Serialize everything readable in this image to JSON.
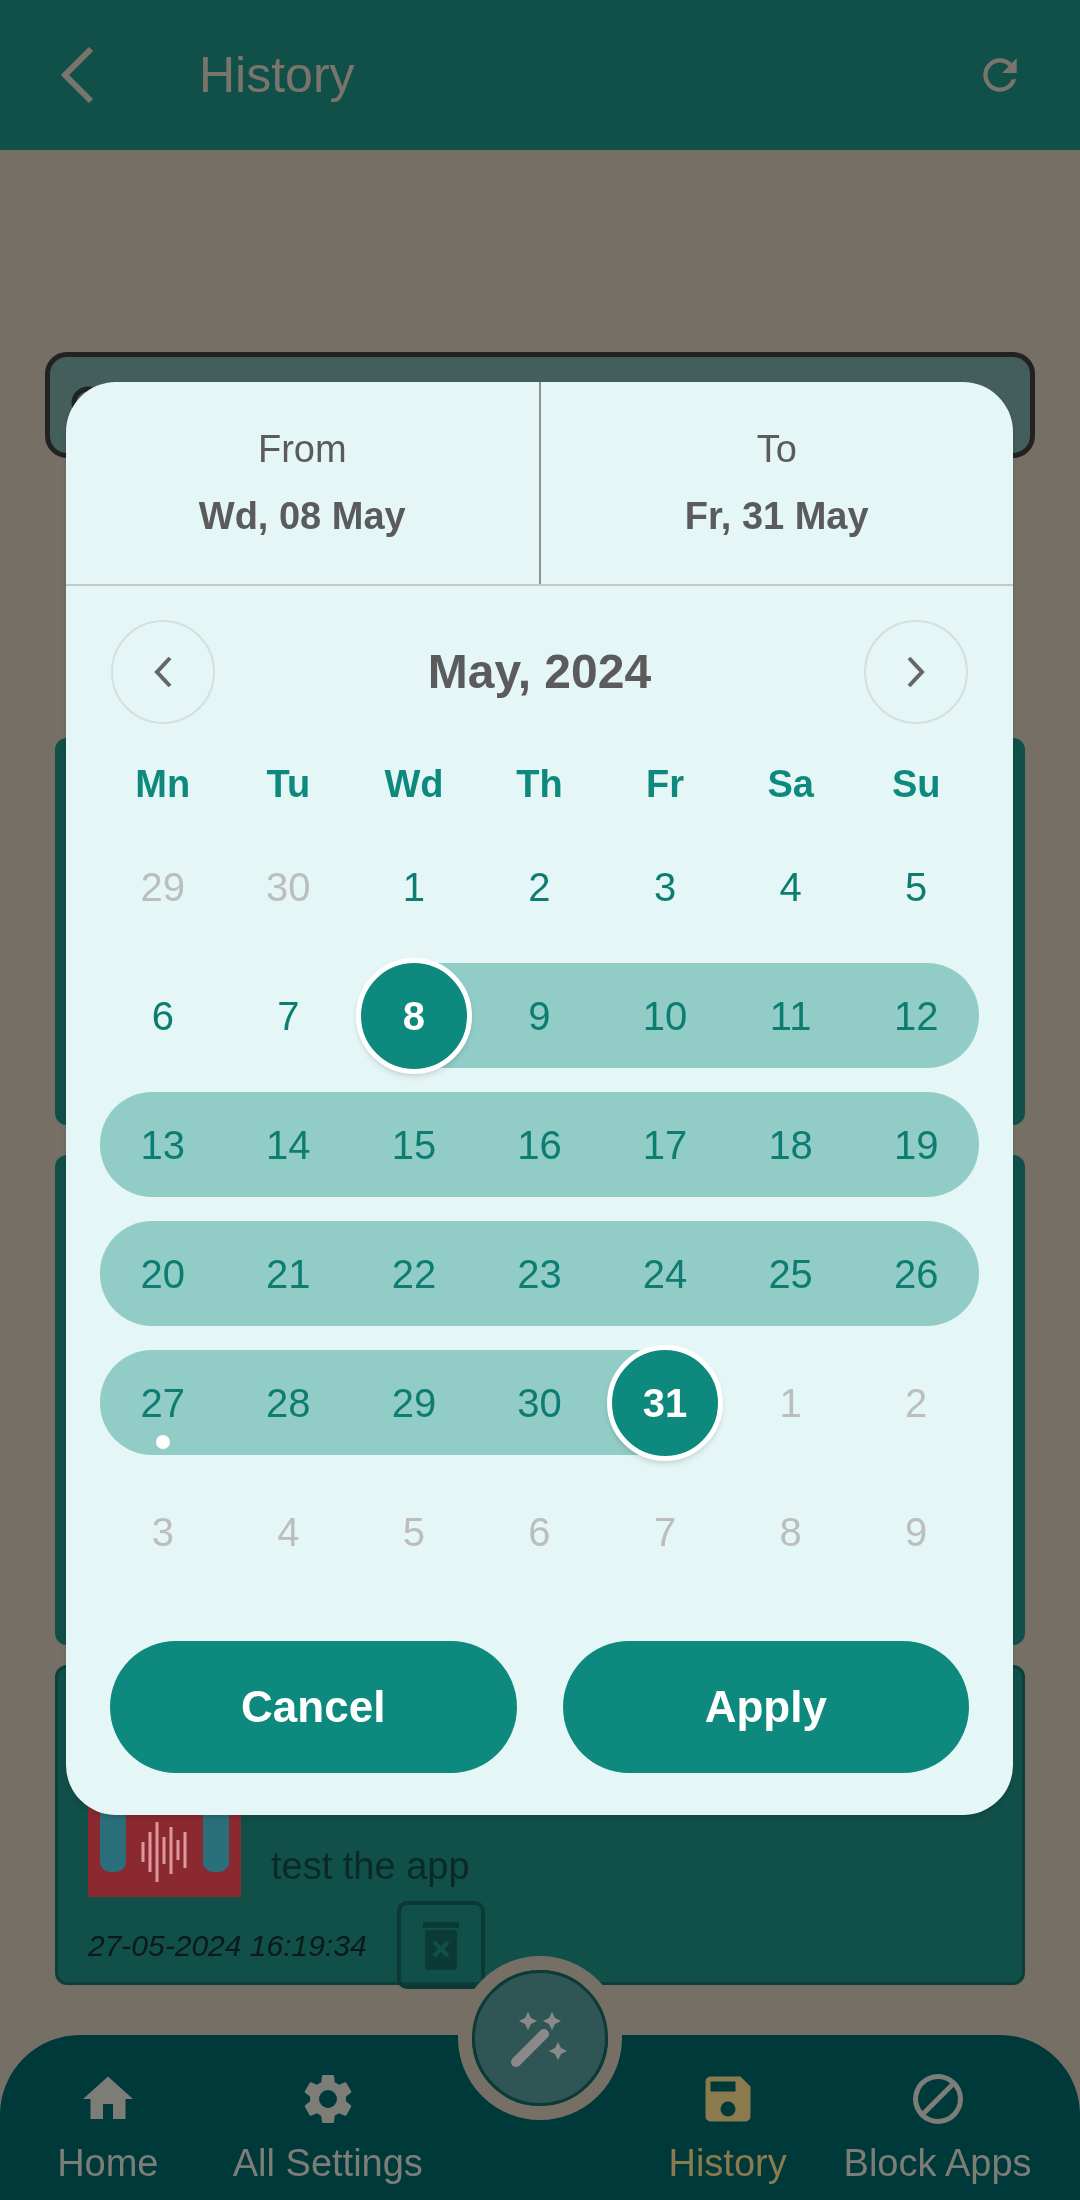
{
  "header": {
    "title": "History"
  },
  "history_item": {
    "title": "test the app",
    "timestamp": "27-05-2024 16:19:34"
  },
  "date_picker": {
    "from": {
      "label": "From",
      "value": "Wd, 08 May"
    },
    "to": {
      "label": "To",
      "value": "Fr, 31 May"
    },
    "month": "May, 2024",
    "weekdays": [
      "Mn",
      "Tu",
      "Wd",
      "Th",
      "Fr",
      "Sa",
      "Su"
    ],
    "weeks": [
      [
        {
          "day": "29",
          "outside": true,
          "in_range": false,
          "selected": false,
          "today": false
        },
        {
          "day": "30",
          "outside": true,
          "in_range": false,
          "selected": false,
          "today": false
        },
        {
          "day": "1",
          "outside": false,
          "in_range": false,
          "selected": false,
          "today": false
        },
        {
          "day": "2",
          "outside": false,
          "in_range": false,
          "selected": false,
          "today": false
        },
        {
          "day": "3",
          "outside": false,
          "in_range": false,
          "selected": false,
          "today": false
        },
        {
          "day": "4",
          "outside": false,
          "in_range": false,
          "selected": false,
          "today": false
        },
        {
          "day": "5",
          "outside": false,
          "in_range": false,
          "selected": false,
          "today": false
        }
      ],
      [
        {
          "day": "6",
          "outside": false,
          "in_range": false,
          "selected": false,
          "today": false
        },
        {
          "day": "7",
          "outside": false,
          "in_range": false,
          "selected": false,
          "today": false
        },
        {
          "day": "8",
          "outside": false,
          "in_range": true,
          "selected": true,
          "today": false
        },
        {
          "day": "9",
          "outside": false,
          "in_range": true,
          "selected": false,
          "today": false
        },
        {
          "day": "10",
          "outside": false,
          "in_range": true,
          "selected": false,
          "today": false
        },
        {
          "day": "11",
          "outside": false,
          "in_range": true,
          "selected": false,
          "today": false
        },
        {
          "day": "12",
          "outside": false,
          "in_range": true,
          "selected": false,
          "today": false
        }
      ],
      [
        {
          "day": "13",
          "outside": false,
          "in_range": true,
          "selected": false,
          "today": false
        },
        {
          "day": "14",
          "outside": false,
          "in_range": true,
          "selected": false,
          "today": false
        },
        {
          "day": "15",
          "outside": false,
          "in_range": true,
          "selected": false,
          "today": false
        },
        {
          "day": "16",
          "outside": false,
          "in_range": true,
          "selected": false,
          "today": false
        },
        {
          "day": "17",
          "outside": false,
          "in_range": true,
          "selected": false,
          "today": false
        },
        {
          "day": "18",
          "outside": false,
          "in_range": true,
          "selected": false,
          "today": false
        },
        {
          "day": "19",
          "outside": false,
          "in_range": true,
          "selected": false,
          "today": false
        }
      ],
      [
        {
          "day": "20",
          "outside": false,
          "in_range": true,
          "selected": false,
          "today": false
        },
        {
          "day": "21",
          "outside": false,
          "in_range": true,
          "selected": false,
          "today": false
        },
        {
          "day": "22",
          "outside": false,
          "in_range": true,
          "selected": false,
          "today": false
        },
        {
          "day": "23",
          "outside": false,
          "in_range": true,
          "selected": false,
          "today": false
        },
        {
          "day": "24",
          "outside": false,
          "in_range": true,
          "selected": false,
          "today": false
        },
        {
          "day": "25",
          "outside": false,
          "in_range": true,
          "selected": false,
          "today": false
        },
        {
          "day": "26",
          "outside": false,
          "in_range": true,
          "selected": false,
          "today": false
        }
      ],
      [
        {
          "day": "27",
          "outside": false,
          "in_range": true,
          "selected": false,
          "today": true
        },
        {
          "day": "28",
          "outside": false,
          "in_range": true,
          "selected": false,
          "today": false
        },
        {
          "day": "29",
          "outside": false,
          "in_range": true,
          "selected": false,
          "today": false
        },
        {
          "day": "30",
          "outside": false,
          "in_range": true,
          "selected": false,
          "today": false
        },
        {
          "day": "31",
          "outside": false,
          "in_range": true,
          "selected": true,
          "today": false
        },
        {
          "day": "1",
          "outside": true,
          "in_range": false,
          "selected": false,
          "today": false
        },
        {
          "day": "2",
          "outside": true,
          "in_range": false,
          "selected": false,
          "today": false
        }
      ],
      [
        {
          "day": "3",
          "outside": true,
          "in_range": false,
          "selected": false,
          "today": false
        },
        {
          "day": "4",
          "outside": true,
          "in_range": false,
          "selected": false,
          "today": false
        },
        {
          "day": "5",
          "outside": true,
          "in_range": false,
          "selected": false,
          "today": false
        },
        {
          "day": "6",
          "outside": true,
          "in_range": false,
          "selected": false,
          "today": false
        },
        {
          "day": "7",
          "outside": true,
          "in_range": false,
          "selected": false,
          "today": false
        },
        {
          "day": "8",
          "outside": true,
          "in_range": false,
          "selected": false,
          "today": false
        },
        {
          "day": "9",
          "outside": true,
          "in_range": false,
          "selected": false,
          "today": false
        }
      ]
    ],
    "buttons": [
      "Cancel",
      "Apply"
    ]
  },
  "nav": [
    {
      "label": "Home",
      "selected": false
    },
    {
      "label": "All Settings",
      "selected": false
    },
    {
      "label": "History",
      "selected": true
    },
    {
      "label": "Block Apps",
      "selected": false
    }
  ]
}
